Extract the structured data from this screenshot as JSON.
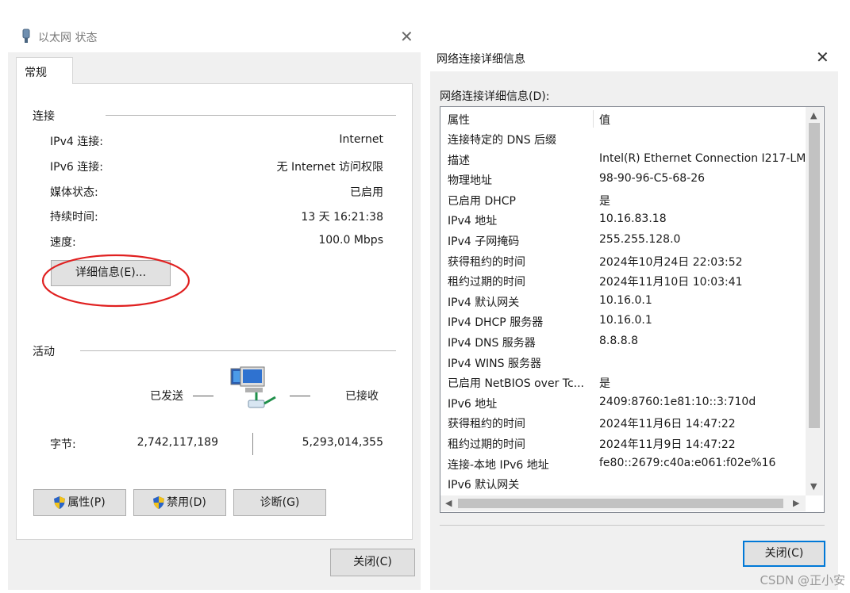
{
  "status_dialog": {
    "title": "以太网 状态",
    "tab_label": "常规",
    "connection": {
      "group_label": "连接",
      "rows": [
        {
          "label": "IPv4 连接:",
          "value": "Internet"
        },
        {
          "label": "IPv6 连接:",
          "value": "无 Internet 访问权限"
        },
        {
          "label": "媒体状态:",
          "value": "已启用"
        },
        {
          "label": "持续时间:",
          "value": "13 天 16:21:38"
        },
        {
          "label": "速度:",
          "value": "100.0 Mbps"
        }
      ],
      "details_button": "详细信息(E)..."
    },
    "activity": {
      "group_label": "活动",
      "sent_label": "已发送",
      "received_label": "已接收",
      "bytes_label": "字节:",
      "bytes_sent": "2,742,117,189",
      "bytes_received": "5,293,014,355"
    },
    "buttons": {
      "properties": "属性(P)",
      "disable": "禁用(D)",
      "diagnose": "诊断(G)",
      "close": "关闭(C)"
    }
  },
  "details_dialog": {
    "title": "网络连接详细信息",
    "list_label": "网络连接详细信息(D):",
    "columns": {
      "property": "属性",
      "value": "值"
    },
    "rows": [
      {
        "property": "连接特定的 DNS 后缀",
        "value": ""
      },
      {
        "property": "描述",
        "value": "Intel(R) Ethernet Connection I217-LM"
      },
      {
        "property": "物理地址",
        "value": "98-90-96-C5-68-26"
      },
      {
        "property": "已启用 DHCP",
        "value": "是"
      },
      {
        "property": "IPv4 地址",
        "value": "10.16.83.18"
      },
      {
        "property": "IPv4 子网掩码",
        "value": "255.255.128.0"
      },
      {
        "property": "获得租约的时间",
        "value": "2024年10月24日 22:03:52"
      },
      {
        "property": "租约过期的时间",
        "value": "2024年11月10日 10:03:41"
      },
      {
        "property": "IPv4 默认网关",
        "value": "10.16.0.1"
      },
      {
        "property": "IPv4 DHCP 服务器",
        "value": "10.16.0.1"
      },
      {
        "property": "IPv4 DNS 服务器",
        "value": "8.8.8.8"
      },
      {
        "property": "IPv4 WINS 服务器",
        "value": ""
      },
      {
        "property": "已启用 NetBIOS over Tc...",
        "value": "是"
      },
      {
        "property": "IPv6 地址",
        "value": "2409:8760:1e81:10::3:710d"
      },
      {
        "property": "获得租约的时间",
        "value": "2024年11月6日 14:47:22"
      },
      {
        "property": "租约过期的时间",
        "value": "2024年11月9日 14:47:22"
      },
      {
        "property": "连接-本地 IPv6 地址",
        "value": "fe80::2679:c40a:e061:f02e%16"
      },
      {
        "property": "IPv6 默认网关",
        "value": ""
      }
    ],
    "close_button": "关闭(C)"
  },
  "watermark": "CSDN @正小安",
  "colors": {
    "window_bg": "#f0f0f0",
    "annotation_red": "#e02020",
    "focus_border": "#0078d7"
  }
}
